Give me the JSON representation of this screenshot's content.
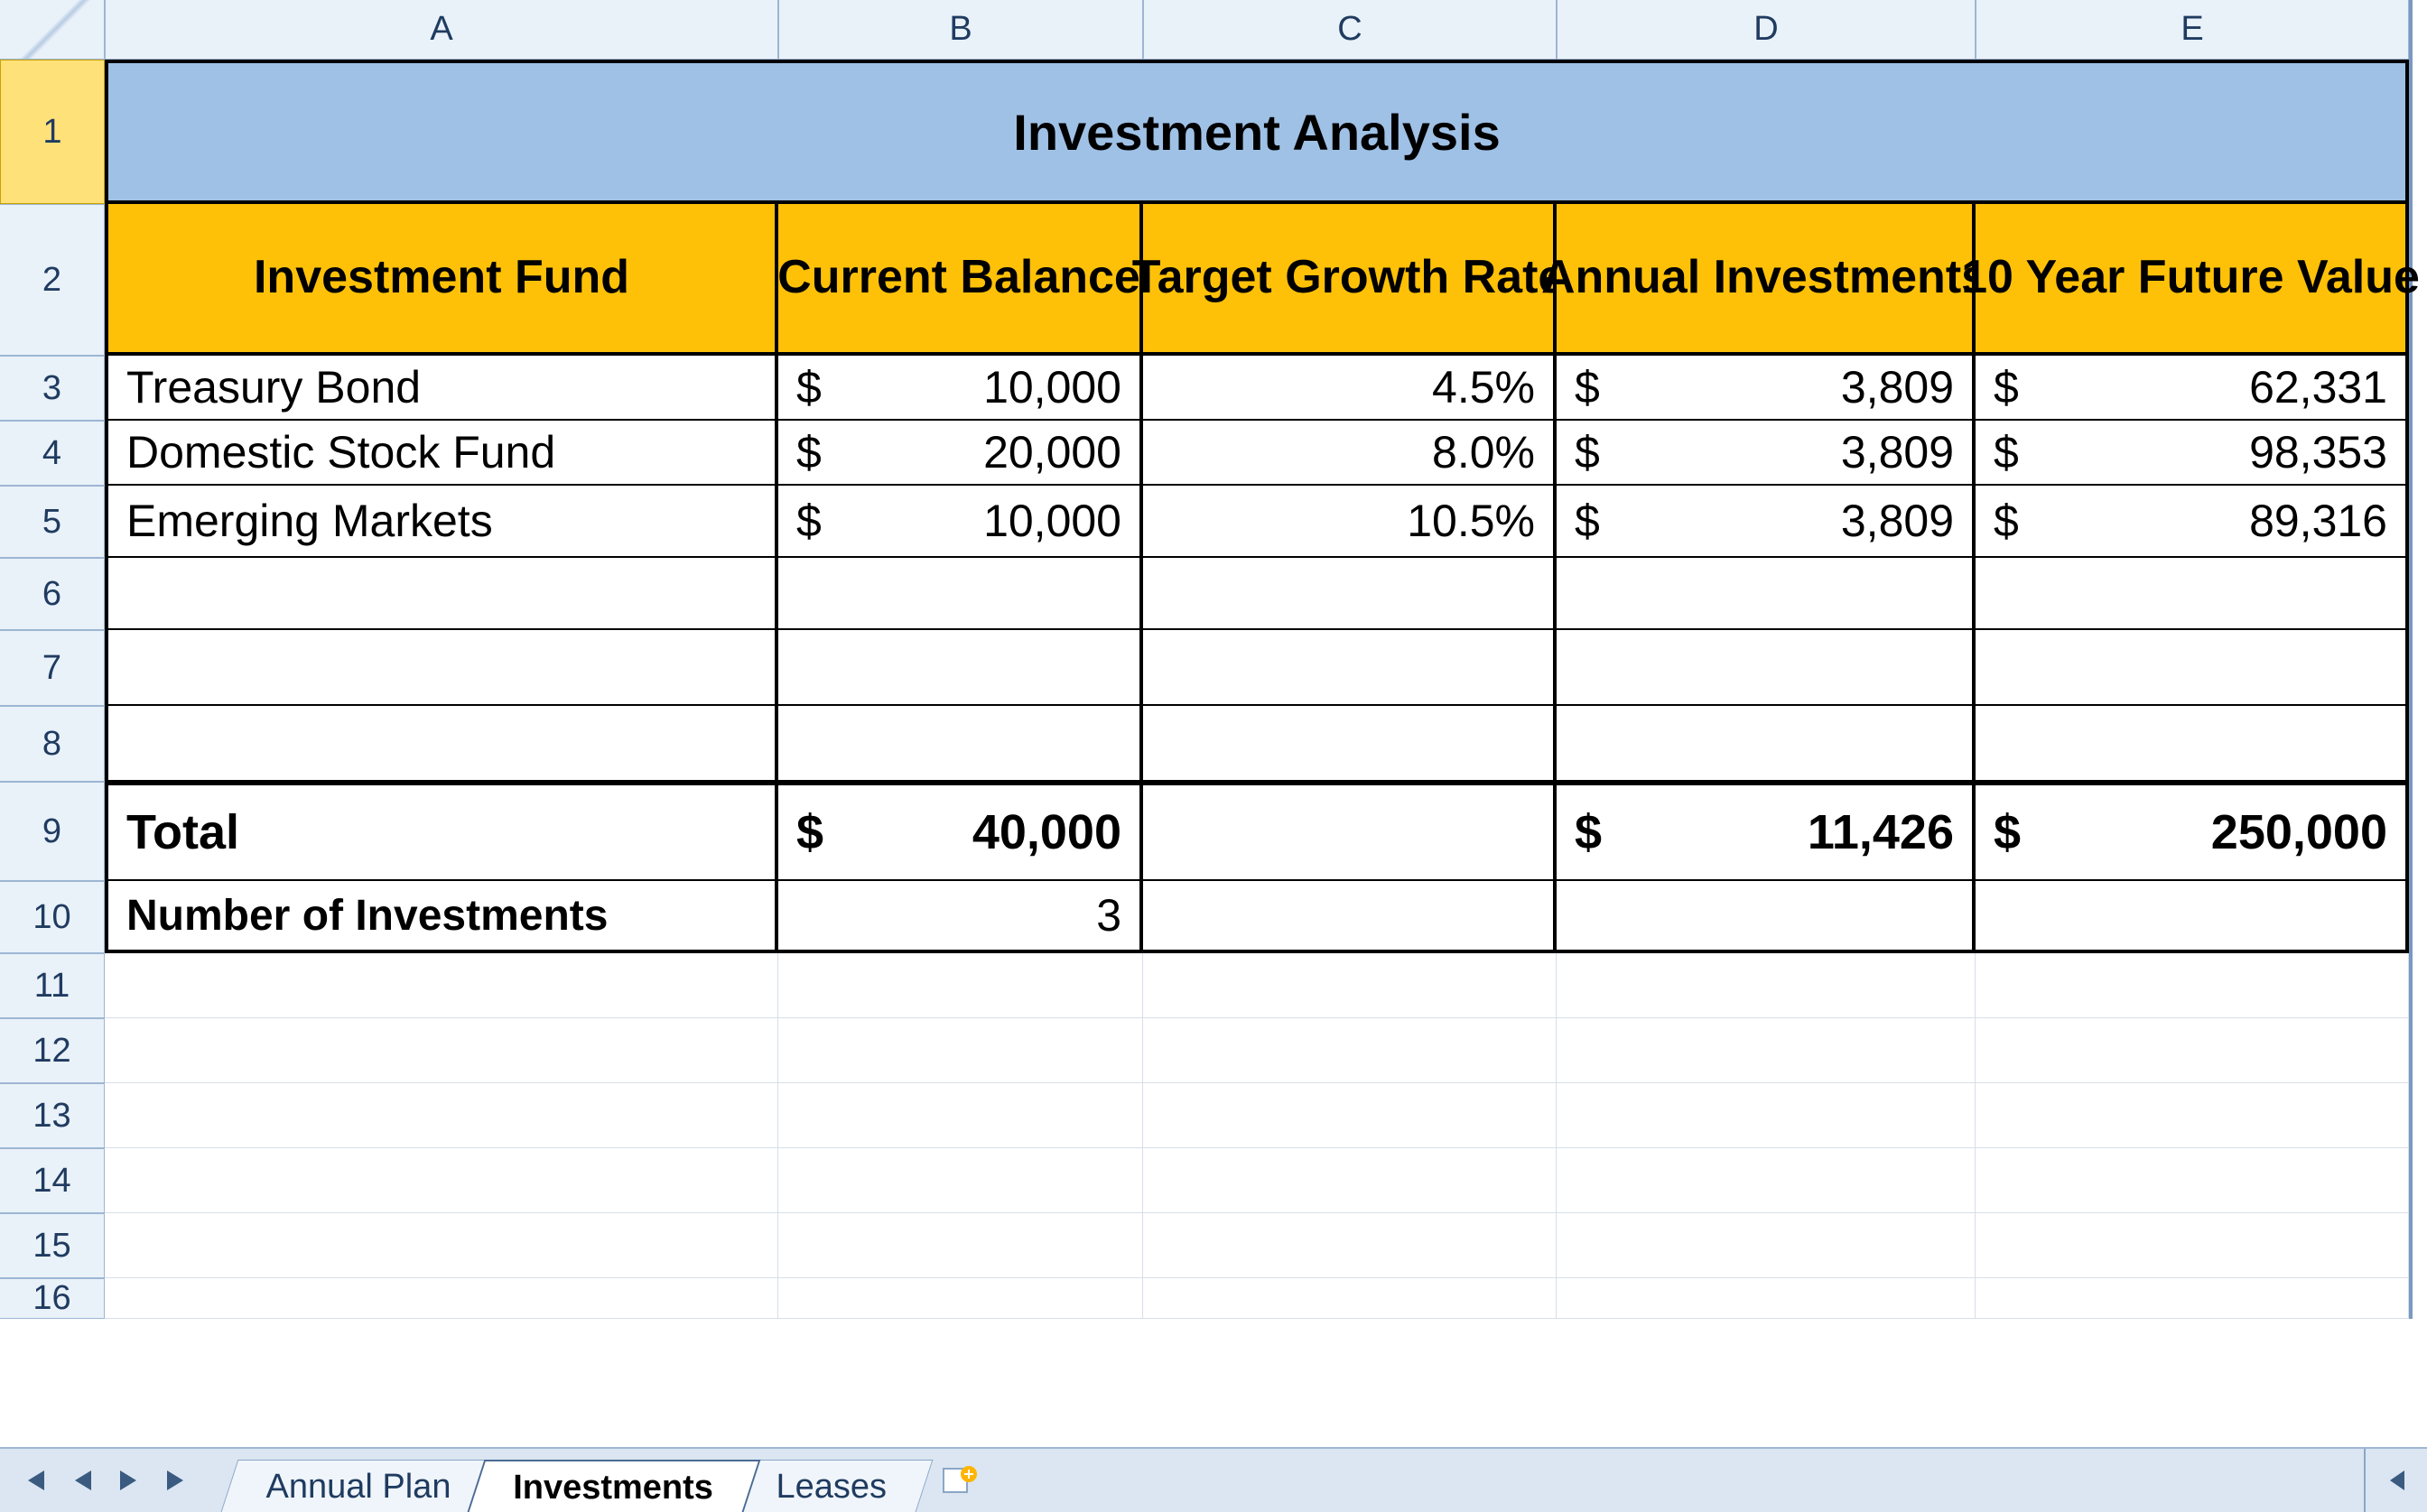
{
  "columns": [
    "A",
    "B",
    "C",
    "D",
    "E"
  ],
  "row_numbers": [
    "1",
    "2",
    "3",
    "4",
    "5",
    "6",
    "7",
    "8",
    "9",
    "10",
    "11",
    "12",
    "13",
    "14",
    "15",
    "16"
  ],
  "selected_row_header": "1",
  "title": "Investment Analysis",
  "headers": {
    "fund": "Investment Fund",
    "balance": "Current Balance",
    "growth": "Target Growth Rate",
    "annual": "Annual Investments",
    "future": "10 Year Future Value"
  },
  "rows": [
    {
      "fund": "Treasury Bond",
      "balance": "10,000",
      "growth": "4.5%",
      "annual": "3,809",
      "future": "62,331"
    },
    {
      "fund": "Domestic Stock Fund",
      "balance": "20,000",
      "growth": "8.0%",
      "annual": "3,809",
      "future": "98,353"
    },
    {
      "fund": "Emerging Markets",
      "balance": "10,000",
      "growth": "10.5%",
      "annual": "3,809",
      "future": "89,316"
    }
  ],
  "total": {
    "label": "Total",
    "balance": "40,000",
    "annual": "11,426",
    "future": "250,000"
  },
  "count_row": {
    "label": "Number of Investments",
    "value": "3"
  },
  "currency_symbol": "$",
  "tabs": [
    "Annual Plan",
    "Investments",
    "Leases"
  ],
  "active_tab": "Investments",
  "colors": {
    "title_bg": "#9fc1e6",
    "header_bg": "#ffc107",
    "heading_fg": "#1f3b60"
  },
  "chart_data": {
    "type": "table",
    "title": "Investment Analysis",
    "columns": [
      "Investment Fund",
      "Current Balance",
      "Target Growth Rate",
      "Annual Investments",
      "10 Year Future Value"
    ],
    "rows": [
      [
        "Treasury Bond",
        10000,
        0.045,
        3809,
        62331
      ],
      [
        "Domestic Stock Fund",
        20000,
        0.08,
        3809,
        98353
      ],
      [
        "Emerging Markets",
        10000,
        0.105,
        3809,
        89316
      ]
    ],
    "totals": {
      "Current Balance": 40000,
      "Annual Investments": 11426,
      "10 Year Future Value": 250000
    },
    "number_of_investments": 3
  }
}
